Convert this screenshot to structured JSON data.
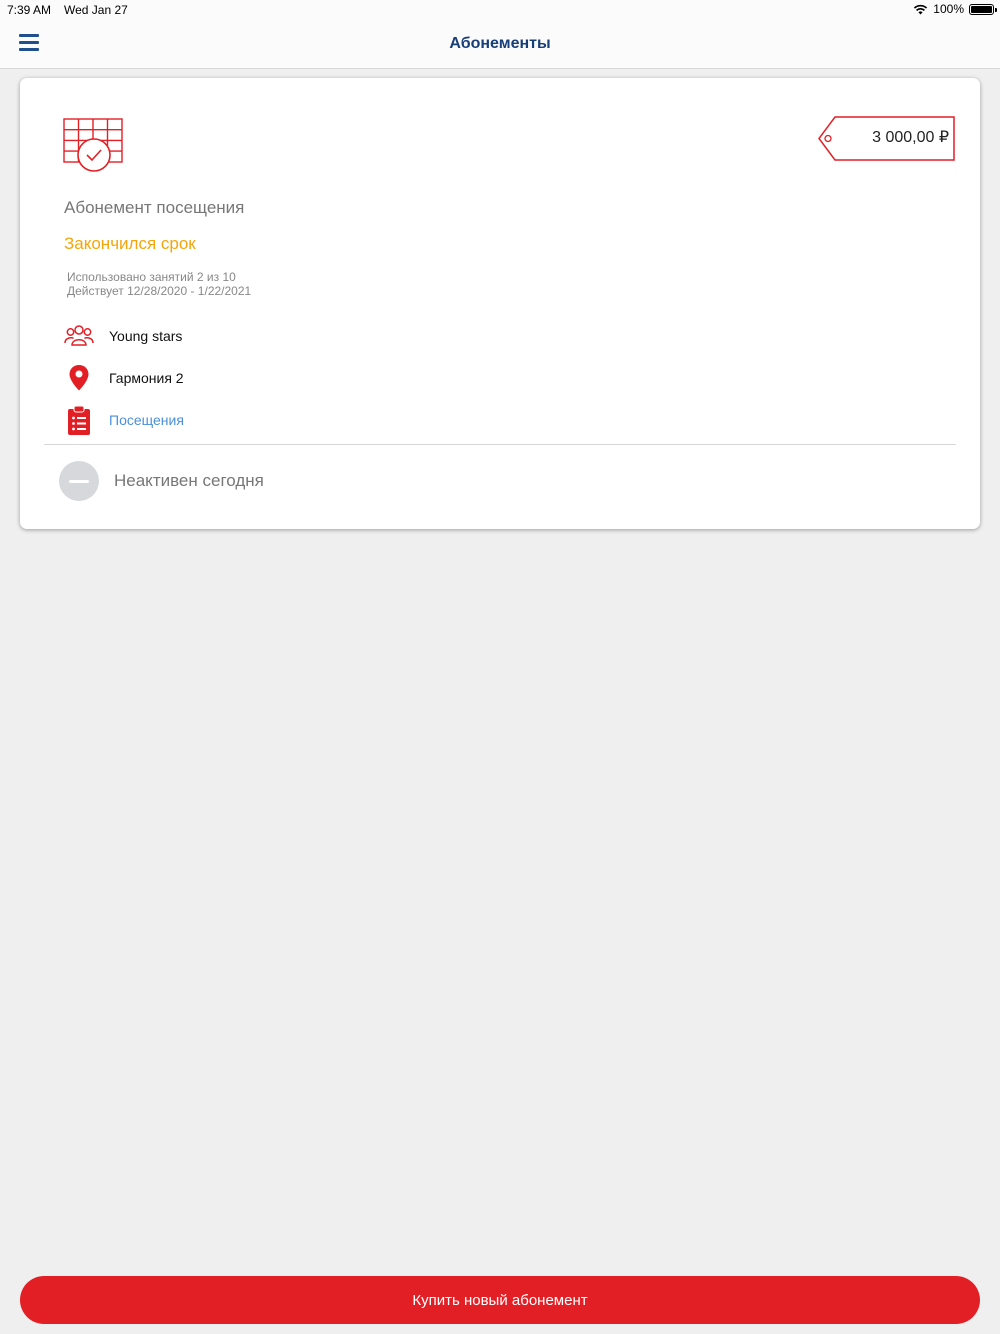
{
  "status_bar": {
    "time": "7:39 AM",
    "date": "Wed Jan 27",
    "battery": "100%"
  },
  "header": {
    "title": "Абонементы"
  },
  "subscription": {
    "price": "3 000,00 ₽",
    "title": "Абонемент посещения",
    "status": "Закончился срок",
    "used": "Использовано занятий 2 из 10",
    "valid": "Действует 12/28/2020 - 1/22/2021",
    "group": "Young stars",
    "location": "Гармония 2",
    "visits_link": "Посещения",
    "today_status": "Неактивен сегодня"
  },
  "footer": {
    "buy_button": "Купить новый абонемент"
  },
  "colors": {
    "accent": "#e31f26",
    "warning": "#f4a50b",
    "nav": "#183e78",
    "link": "#4a90d9"
  }
}
